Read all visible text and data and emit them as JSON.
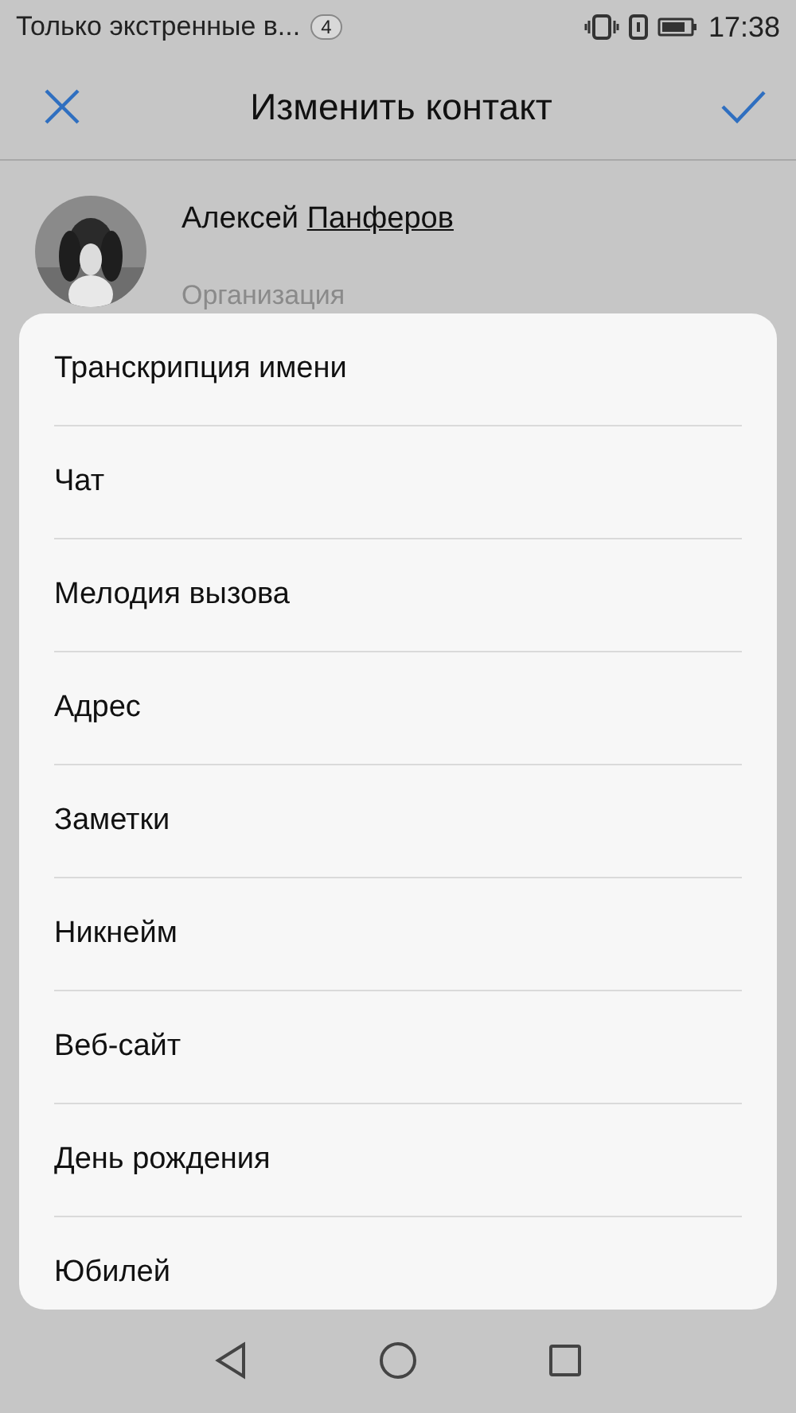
{
  "status_bar": {
    "notification": "Только экстренные в...",
    "badge": "4",
    "time": "17:38"
  },
  "header": {
    "title": "Изменить контакт"
  },
  "contact": {
    "first_name": "Алексей",
    "last_name": "Панферов",
    "organization_placeholder": "Организация"
  },
  "menu": {
    "items": [
      {
        "label": "Транскрипция имени"
      },
      {
        "label": "Чат"
      },
      {
        "label": "Мелодия вызова"
      },
      {
        "label": "Адрес"
      },
      {
        "label": "Заметки"
      },
      {
        "label": "Никнейм"
      },
      {
        "label": "Веб-сайт"
      },
      {
        "label": "День рождения"
      },
      {
        "label": "Юбилей"
      }
    ]
  }
}
